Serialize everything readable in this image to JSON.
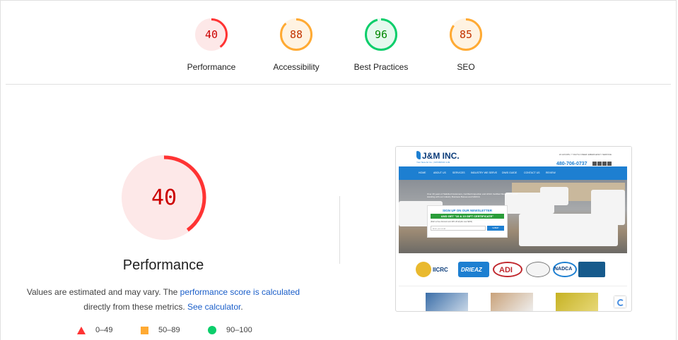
{
  "gauges": [
    {
      "score": "40",
      "label": "Performance",
      "color": "#ff3333",
      "bg": "#fde8e8",
      "text": "#c00",
      "fraction": 0.4
    },
    {
      "score": "88",
      "label": "Accessibility",
      "color": "#ffaa33",
      "bg": "#fff3e2",
      "text": "#c33300",
      "fraction": 0.88
    },
    {
      "score": "96",
      "label": "Best Practices",
      "color": "#0cce6b",
      "bg": "#e5f9ee",
      "text": "#008800",
      "fraction": 0.96
    },
    {
      "score": "85",
      "label": "SEO",
      "color": "#ffaa33",
      "bg": "#fff3e2",
      "text": "#c33300",
      "fraction": 0.85
    }
  ],
  "main": {
    "score": "40",
    "fraction": 0.4,
    "title": "Performance",
    "desc_prefix": "Values are estimated and may vary. The ",
    "desc_link1": "performance score is calculated",
    "desc_middle": " directly from these metrics. ",
    "desc_link2": "See calculator",
    "desc_suffix": ".",
    "colors": {
      "fail": "#ff3333",
      "average": "#ffaa33",
      "pass": "#0cce6b"
    }
  },
  "legend": [
    {
      "range": "0–49",
      "icon": "red-triangle-icon"
    },
    {
      "range": "50–89",
      "icon": "orange-square-icon"
    },
    {
      "range": "90–100",
      "icon": "green-circle-icon"
    }
  ],
  "screenshot": {
    "logo": "J&M INC.",
    "tagline": "Your New Air Co. | 60745/IICR 4-49",
    "header_small": "24 HOURS / 7 DAYS A WEEK EMERGENCY SERVICE",
    "phone": "480-706-0737",
    "nav": [
      "HOME",
      "ABOUT US",
      "SERVICES",
      "INDUSTRY WE SERVE",
      "DIWS GUIDE",
      "CONTACT US",
      "REVIEW"
    ],
    "hero_text": "Over 20 years of Satisfied Customers, Certified Inspection and HVAC Certified Members in good standing with our industry Business Bureau and NADCA",
    "newsletter_title": "SIGN UP ON OUR NEWSLETTER",
    "newsletter_offer": "AND GET \"10 & 10 GIFT CERTIFICATE\"",
    "newsletter_small": "(that's a free discount and 10% off all jobs over $200)",
    "newsletter_placeholder": "Enter your email",
    "newsletter_button": "SUBMIT",
    "badges": [
      "IICRC",
      "DRIEAZ",
      "ADI",
      "NADCA"
    ]
  }
}
